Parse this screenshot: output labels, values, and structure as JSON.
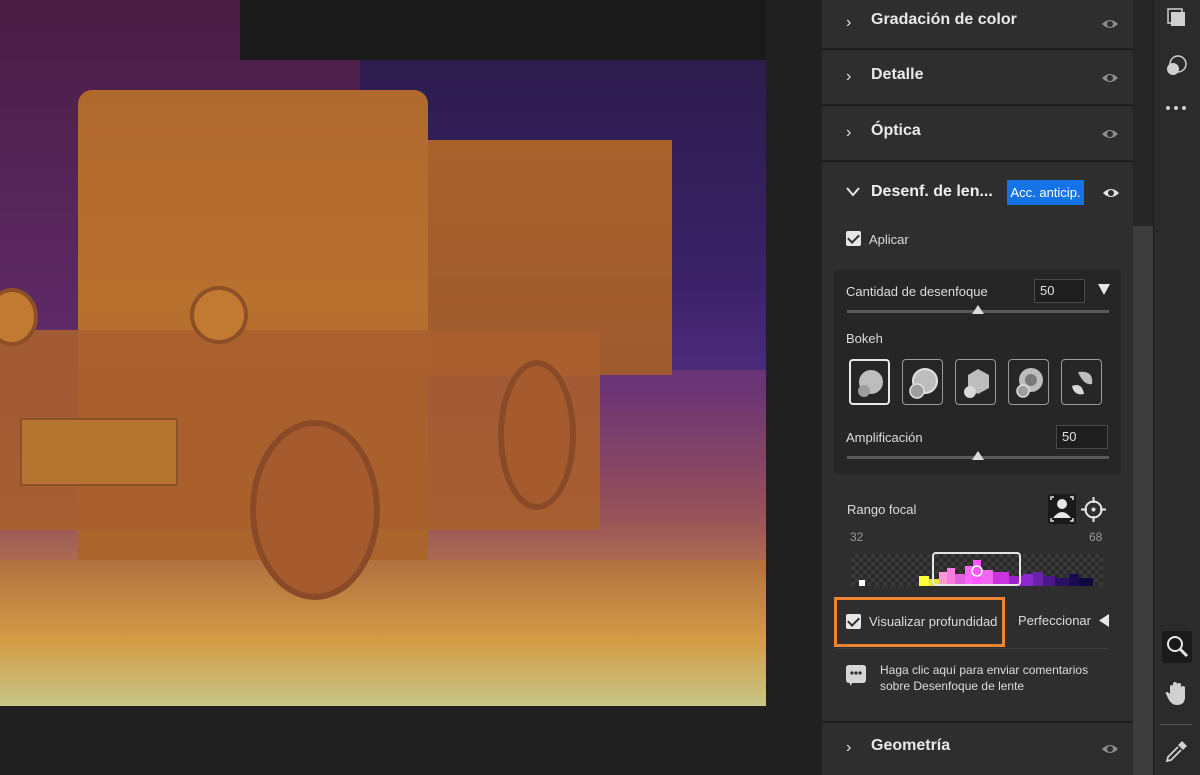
{
  "panel": {
    "sections_top": [
      {
        "title": "Gradación de color"
      },
      {
        "title": "Detalle"
      },
      {
        "title": "Óptica"
      }
    ],
    "lens_blur": {
      "title": "Desenf. de len...",
      "badge": "Acc. anticip.",
      "apply_label": "Aplicar",
      "apply_checked": true,
      "blur_amount_label": "Cantidad de desenfoque",
      "blur_amount_value": "50",
      "bokeh_label": "Bokeh",
      "bokeh_shapes": [
        "bokeh-circle",
        "bokeh-bubble",
        "bokeh-blade",
        "bokeh-ring",
        "bokeh-cat-eye"
      ],
      "boost_label": "Amplificación",
      "boost_value": "50",
      "focal_range_label": "Rango focal",
      "focal_min": "32",
      "focal_max": "68",
      "visualize_depth_label": "Visualizar profundidad",
      "visualize_depth_checked": true,
      "refine_label": "Perfeccionar",
      "feedback_text_line1": "Haga clic aquí para enviar comentarios",
      "feedback_text_line2": "sobre Desenfoque de lente"
    },
    "sections_bottom": [
      {
        "title": "Geometría"
      }
    ]
  },
  "toolstrip": {
    "tools": [
      "layers-icon",
      "mask-icon",
      "more-icon",
      "zoom-icon",
      "hand-icon",
      "eyedropper-icon"
    ]
  },
  "colors": {
    "accent": "#1473e6",
    "highlight": "#f08433",
    "panel_bg": "#2e2e2e"
  }
}
